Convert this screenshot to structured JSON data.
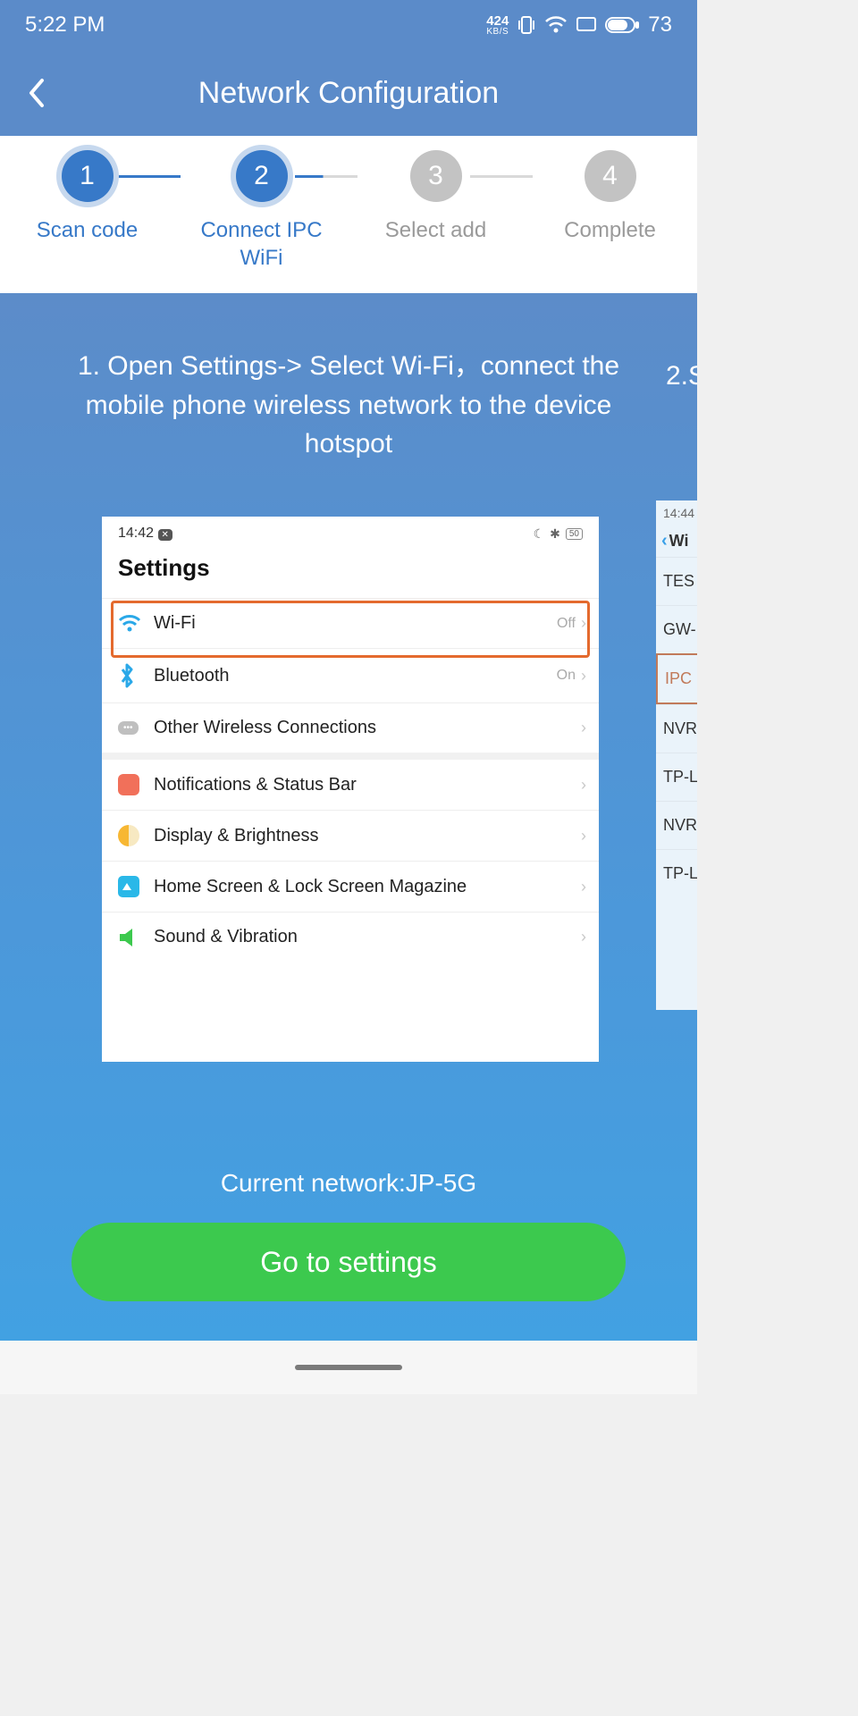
{
  "status": {
    "time": "5:22 PM",
    "kbs_top": "424",
    "kbs_bot": "KB/S",
    "battery": "73"
  },
  "header": {
    "title": "Network Configuration"
  },
  "steps": [
    {
      "num": "1",
      "label": "Scan code",
      "active": true
    },
    {
      "num": "2",
      "label": "Connect IPC WiFi",
      "active": true
    },
    {
      "num": "3",
      "label": "Select add",
      "active": false
    },
    {
      "num": "4",
      "label": "Complete",
      "active": false
    }
  ],
  "instruction1": "1. Open Settings-> Select Wi-Fi，connect the mobile phone wireless network to the device hotspot",
  "instruction2": "2.S",
  "settings_mock": {
    "time": "14:42",
    "batt": "50",
    "title": "Settings",
    "rows": [
      {
        "label": "Wi-Fi",
        "value": "Off"
      },
      {
        "label": "Bluetooth",
        "value": "On"
      },
      {
        "label": "Other Wireless Connections",
        "value": ""
      },
      {
        "label": "Notifications & Status Bar",
        "value": ""
      },
      {
        "label": "Display & Brightness",
        "value": ""
      },
      {
        "label": "Home Screen & Lock Screen Magazine",
        "value": ""
      },
      {
        "label": "Sound & Vibration",
        "value": ""
      }
    ]
  },
  "peek": {
    "time": "14:44",
    "header": "Wi",
    "items": [
      "TES",
      "GW-",
      "IPC",
      "NVR",
      "TP-L",
      "NVR",
      "TP-L"
    ]
  },
  "current_network_label": "Current network:",
  "current_network_value": "JP-5G",
  "go_button": "Go to settings"
}
